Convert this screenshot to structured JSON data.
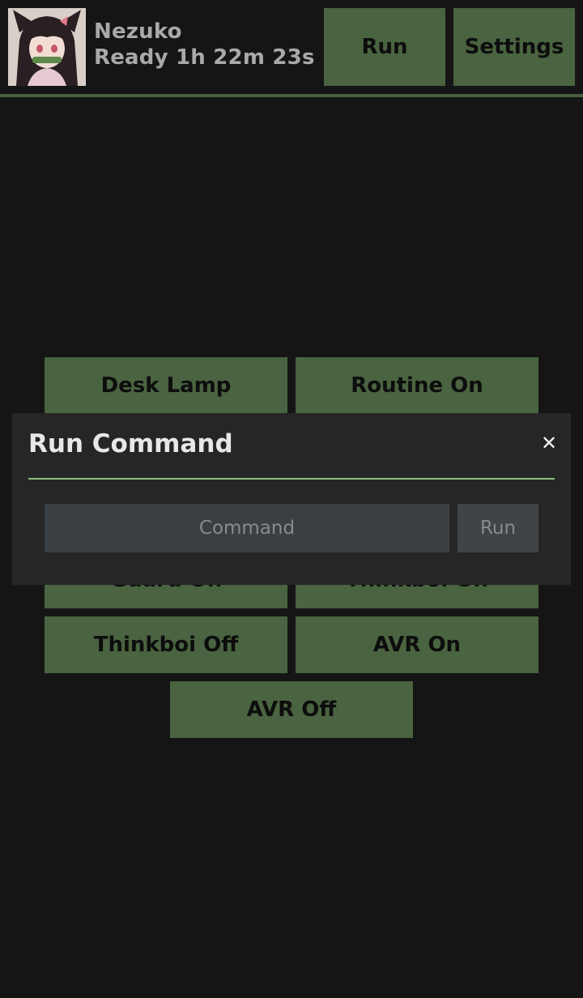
{
  "header": {
    "bot_name": "Nezuko",
    "status": "Ready 1h 22m 23s",
    "run_label": "Run",
    "settings_label": "Settings"
  },
  "commands": [
    "Desk Lamp",
    "Routine On",
    "Guard On",
    "Thinkboi On",
    "Thinkboi Off",
    "AVR On",
    "AVR Off"
  ],
  "modal": {
    "title": "Run Command",
    "close_icon": "close-icon",
    "input_placeholder": "Command",
    "input_value": "",
    "run_label": "Run"
  },
  "colors": {
    "background": "#151515",
    "button_green": "#4a6340",
    "accent_line": "#8fbf7f",
    "modal_bg": "#262626"
  }
}
